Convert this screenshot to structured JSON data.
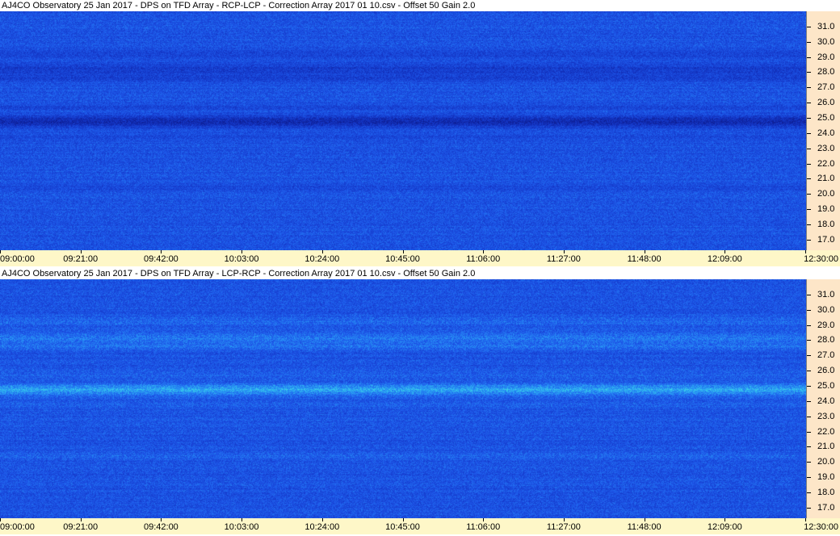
{
  "panels": [
    {
      "title": "AJ4CO Observatory 25 Jan 2017  -  DPS on TFD Array  -  RCP-LCP  -  Correction Array 2017 01 10.csv  -  Offset 50  Gain 2.0",
      "polarity": "RCP-LCP"
    },
    {
      "title": "AJ4CO Observatory 25 Jan 2017  -  DPS on TFD Array  -  LCP-RCP  -  Correction Array 2017 01 10.csv  -  Offset 50  Gain 2.0",
      "polarity": "LCP-RCP"
    }
  ],
  "frequency_axis": {
    "labels": [
      "31.0",
      "30.0",
      "29.0",
      "28.0",
      "27.0",
      "26.0",
      "25.0",
      "24.0",
      "23.0",
      "22.0",
      "21.0",
      "20.0",
      "19.0",
      "18.0",
      "17.0"
    ],
    "min": 16.3,
    "max": 32.0
  },
  "time_axis": {
    "labels": [
      "09:00:00",
      "09:21:00",
      "09:42:00",
      "10:03:00",
      "10:24:00",
      "10:45:00",
      "11:06:00",
      "11:27:00",
      "11:48:00",
      "12:09:00",
      "12:30:00"
    ]
  },
  "colors": {
    "base": "#1a52e6",
    "y_axis_bg": "#fde6c8",
    "x_axis_bg": "#fef7c8"
  }
}
